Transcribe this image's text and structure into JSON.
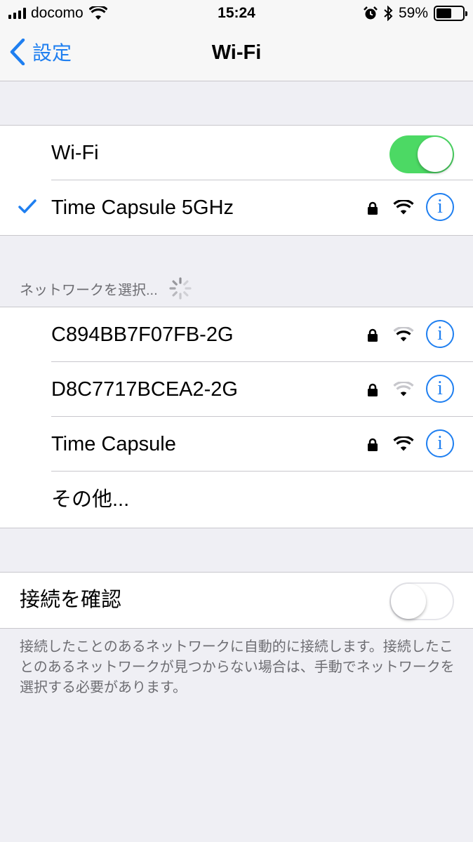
{
  "status_bar": {
    "carrier": "docomo",
    "time": "15:24",
    "battery": "59%",
    "battery_level": 0.59,
    "icons": [
      "signal-bars-icon",
      "wifi-icon",
      "alarm-icon",
      "bluetooth-icon",
      "battery-icon"
    ]
  },
  "nav": {
    "back_label": "設定",
    "title": "Wi-Fi"
  },
  "wifi_toggle": {
    "label": "Wi-Fi",
    "state": "on"
  },
  "connected_network": {
    "name": "Time Capsule 5GHz",
    "secured": true,
    "signal": "full"
  },
  "networks_section": {
    "header": "ネットワークを選択..."
  },
  "networks": [
    {
      "name": "C894BB7F07FB-2G",
      "secured": true,
      "signal": "medium"
    },
    {
      "name": "D8C7717BCEA2-2G",
      "secured": true,
      "signal": "low"
    },
    {
      "name": "Time Capsule",
      "secured": true,
      "signal": "full"
    }
  ],
  "other": {
    "label": "その他..."
  },
  "ask_to_join": {
    "label": "接続を確認",
    "state": "off",
    "footer": "接続したことのあるネットワークに自動的に接続します。接続したことのあるネットワークが見つからない場合は、手動でネットワークを選択する必要があります。"
  },
  "info_glyph": "i",
  "colors": {
    "accent": "#1f7ff0",
    "toggle_on": "#4cd964",
    "background": "#efeff4",
    "secondary_text": "#6d6d72"
  }
}
